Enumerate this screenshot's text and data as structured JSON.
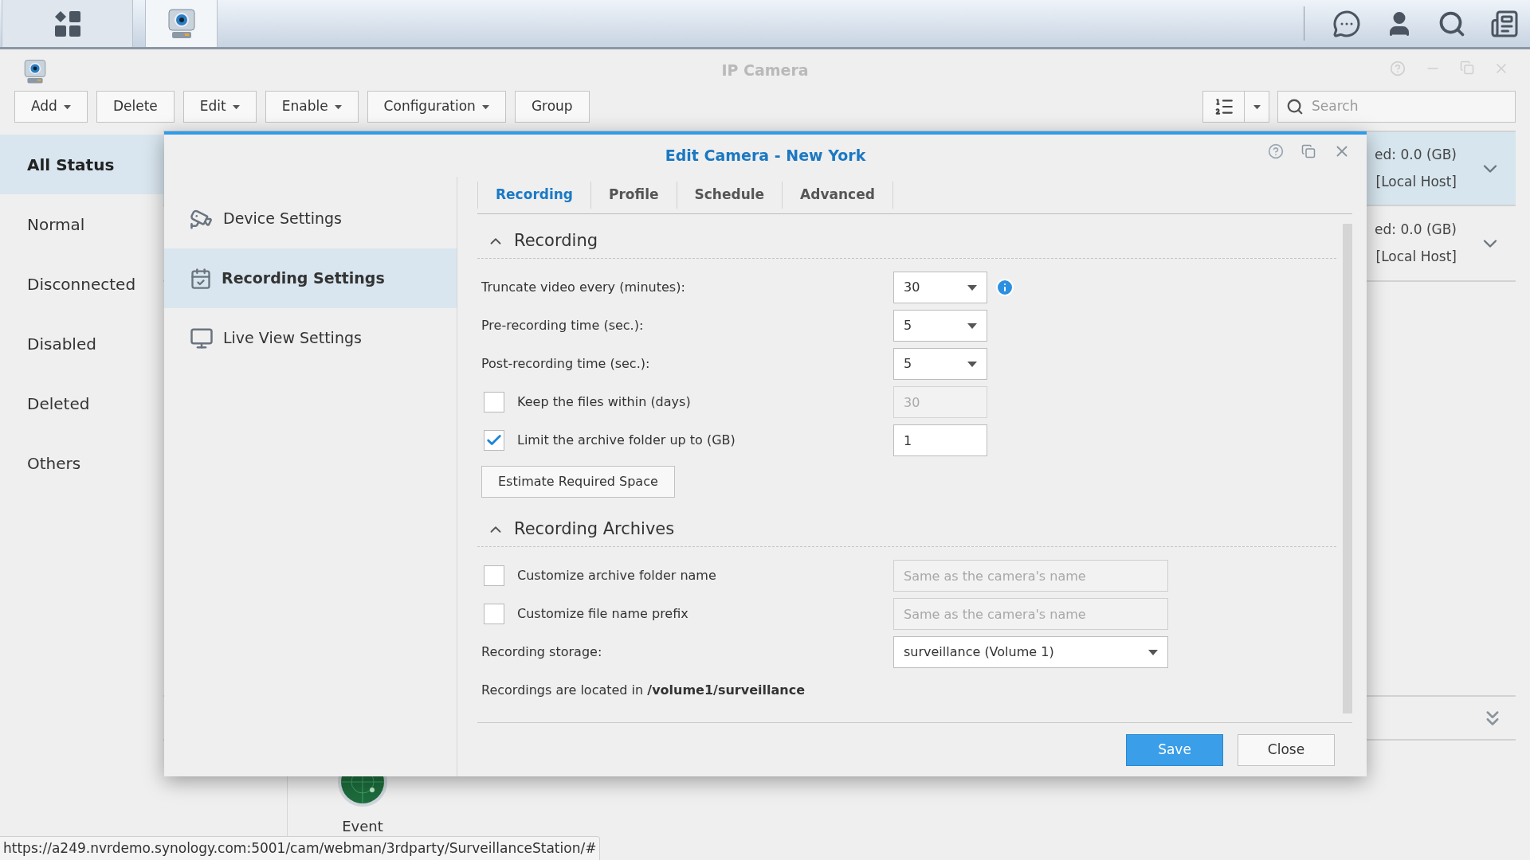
{
  "window": {
    "title": "IP Camera"
  },
  "toolbar": {
    "buttons": [
      {
        "label": "Add",
        "dropdown": true
      },
      {
        "label": "Delete",
        "dropdown": false
      },
      {
        "label": "Edit",
        "dropdown": true
      },
      {
        "label": "Enable",
        "dropdown": true
      },
      {
        "label": "Configuration",
        "dropdown": true
      },
      {
        "label": "Group",
        "dropdown": false
      }
    ],
    "search": {
      "placeholder": "Search"
    }
  },
  "sidebar": {
    "items": [
      {
        "label": "All Status",
        "selected": true
      },
      {
        "label": "Normal",
        "selected": false
      },
      {
        "label": "Disconnected",
        "selected": false
      },
      {
        "label": "Disabled",
        "selected": false
      },
      {
        "label": "Deleted",
        "selected": false
      },
      {
        "label": "Others",
        "selected": false
      }
    ]
  },
  "camera_list": {
    "rows": [
      {
        "column_1": "ed: 0.0 (GB)",
        "column_2": "[Local Host]",
        "selected": true
      },
      {
        "column_1": "ed: 0.0 (GB)",
        "column_2": "[Local Host]",
        "selected": false
      }
    ]
  },
  "app_launcher": {
    "items": [
      {
        "label": "Event"
      }
    ]
  },
  "dialog": {
    "title": "Edit Camera - New York",
    "nav": [
      {
        "label": "Device Settings",
        "selected": false,
        "kind": "device"
      },
      {
        "label": "Recording Settings",
        "selected": true,
        "kind": "recording"
      },
      {
        "label": "Live View Settings",
        "selected": false,
        "kind": "liveview"
      }
    ],
    "tabs": [
      {
        "label": "Recording",
        "selected": true
      },
      {
        "label": "Profile",
        "selected": false
      },
      {
        "label": "Schedule",
        "selected": false
      },
      {
        "label": "Advanced",
        "selected": false
      }
    ],
    "sections": [
      {
        "title": "Recording",
        "expanded": true,
        "rows": [
          {
            "kind": "select",
            "label": "Truncate video every (minutes):",
            "value": "30",
            "info": true
          },
          {
            "kind": "select",
            "label": "Pre-recording time (sec.):",
            "value": "5",
            "info": false
          },
          {
            "kind": "select",
            "label": "Post-recording time (sec.):",
            "value": "5",
            "info": false
          },
          {
            "kind": "checkbox",
            "label": "Keep the files within (days)",
            "checked": false,
            "value": "30"
          },
          {
            "kind": "checkbox",
            "label": "Limit the archive folder up to (GB)",
            "checked": true,
            "value": "1"
          },
          {
            "kind": "button",
            "label": "Estimate Required Space"
          }
        ]
      },
      {
        "title": "Recording Archives",
        "expanded": true,
        "rows": [
          {
            "kind": "checkbox",
            "label": "Customize archive folder name",
            "checked": false,
            "placeholder": "Same as the camera's name"
          },
          {
            "kind": "checkbox",
            "label": "Customize file name prefix",
            "checked": false,
            "placeholder": "Same as the camera's name"
          },
          {
            "kind": "select",
            "label": "Recording storage:",
            "value": "surveillance (Volume 1)",
            "info": false
          },
          {
            "kind": "text",
            "text": "Recordings are located in **/volume1/surveillance**"
          }
        ]
      }
    ],
    "buttons": [
      {
        "label": "Save",
        "kind": "primary"
      },
      {
        "label": "Close",
        "kind": "secondary"
      }
    ]
  },
  "status_url": "https://a249.nvrdemo.synology.com:5001/cam/webman/3rdparty/SurveillanceStation/#"
}
